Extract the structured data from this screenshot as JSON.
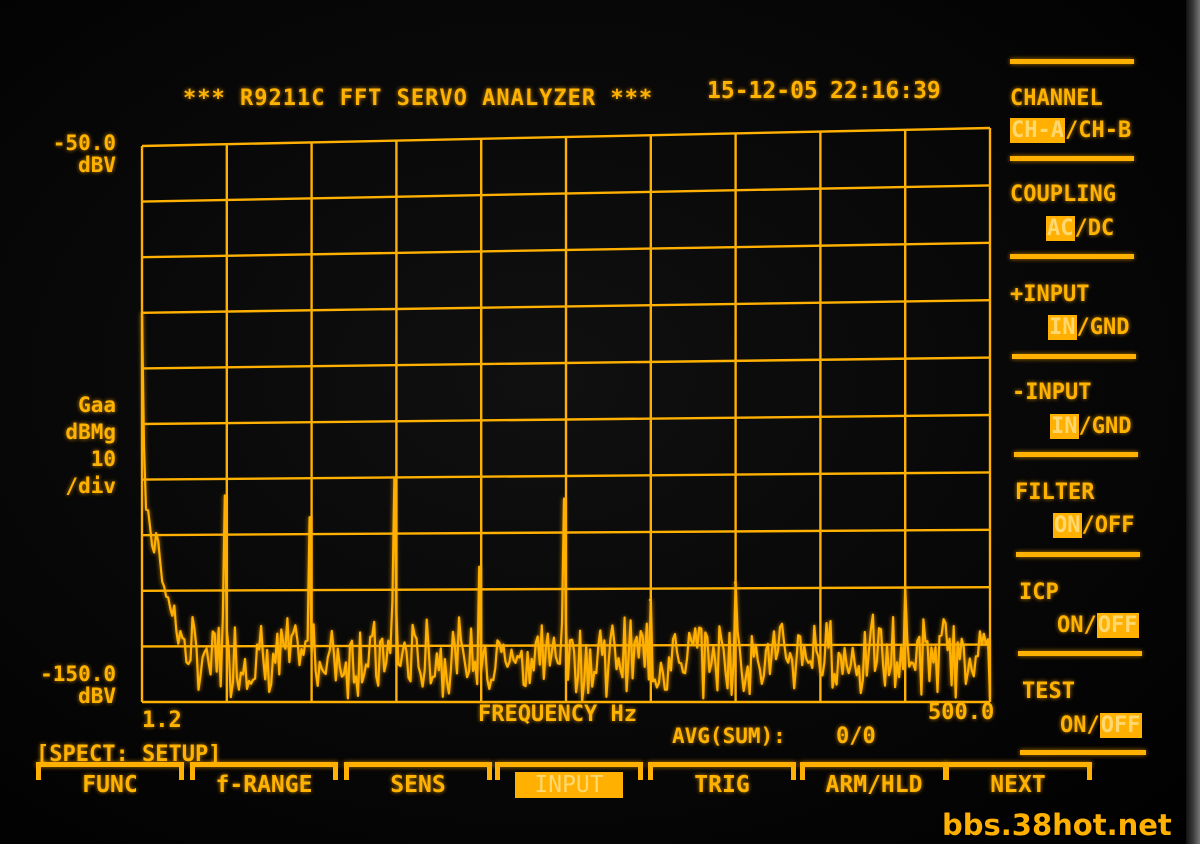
{
  "header": {
    "title": "*** R9211C FFT SERVO ANALYZER ***",
    "date": "15-12-05",
    "time": "22:16:39"
  },
  "plot": {
    "y_top_value": "-50.0",
    "y_top_unit": "dBV",
    "y_bottom_value": "-150.0",
    "y_bottom_unit": "dBV",
    "y_scale_line1": "Gaa",
    "y_scale_line2": "dBMg",
    "y_scale_line3": "10",
    "y_scale_line4": "/div",
    "x_min": "1.2",
    "x_max": "500.0",
    "x_label": "FREQUENCY Hz"
  },
  "status": {
    "mode": "[SPECT: SETUP]",
    "avg_label": "AVG(SUM):",
    "avg_value": "0/0"
  },
  "side_menu": {
    "channel": {
      "title": "CHANNEL",
      "selected": "CH-A",
      "sep": "/",
      "other": "CH-B"
    },
    "coupling": {
      "title": "COUPLING",
      "selected": "AC",
      "sep": "/",
      "other": "DC"
    },
    "plus_input": {
      "title": "+INPUT",
      "selected": "IN",
      "sep": "/",
      "other": "GND"
    },
    "minus_input": {
      "title": "-INPUT",
      "selected": "IN",
      "sep": "/",
      "other": "GND"
    },
    "filter": {
      "title": "FILTER",
      "selected": "ON",
      "sep": "/",
      "other": "OFF"
    },
    "icp": {
      "title": "ICP",
      "other": "ON",
      "sep": "/",
      "selected": "OFF"
    },
    "test": {
      "title": "TEST",
      "other": "ON",
      "sep": "/",
      "selected": "OFF"
    }
  },
  "softkeys": [
    {
      "label": "FUNC"
    },
    {
      "label": "f-RANGE"
    },
    {
      "label": "SENS"
    },
    {
      "label": "INPUT"
    },
    {
      "label": "TRIG"
    },
    {
      "label": "ARM/HLD"
    },
    {
      "label": "NEXT"
    }
  ],
  "watermark": "bbs.38hot.net",
  "chart_data": {
    "type": "line",
    "xlim": [
      1.2,
      500.0
    ],
    "ylim": [
      -150.0,
      -50.0
    ],
    "grid": true,
    "xlabel": "FREQUENCY Hz",
    "ylabel": "dBV",
    "peaks": {
      "x": [
        1.2,
        50,
        100,
        150,
        200,
        250,
        300,
        350,
        450
      ],
      "y": [
        -80,
        -113,
        -117,
        -110,
        -126,
        -114,
        -132,
        -129,
        -130
      ]
    },
    "noise_floor": -145
  },
  "colors": {
    "phosphor": "#ffb000"
  }
}
